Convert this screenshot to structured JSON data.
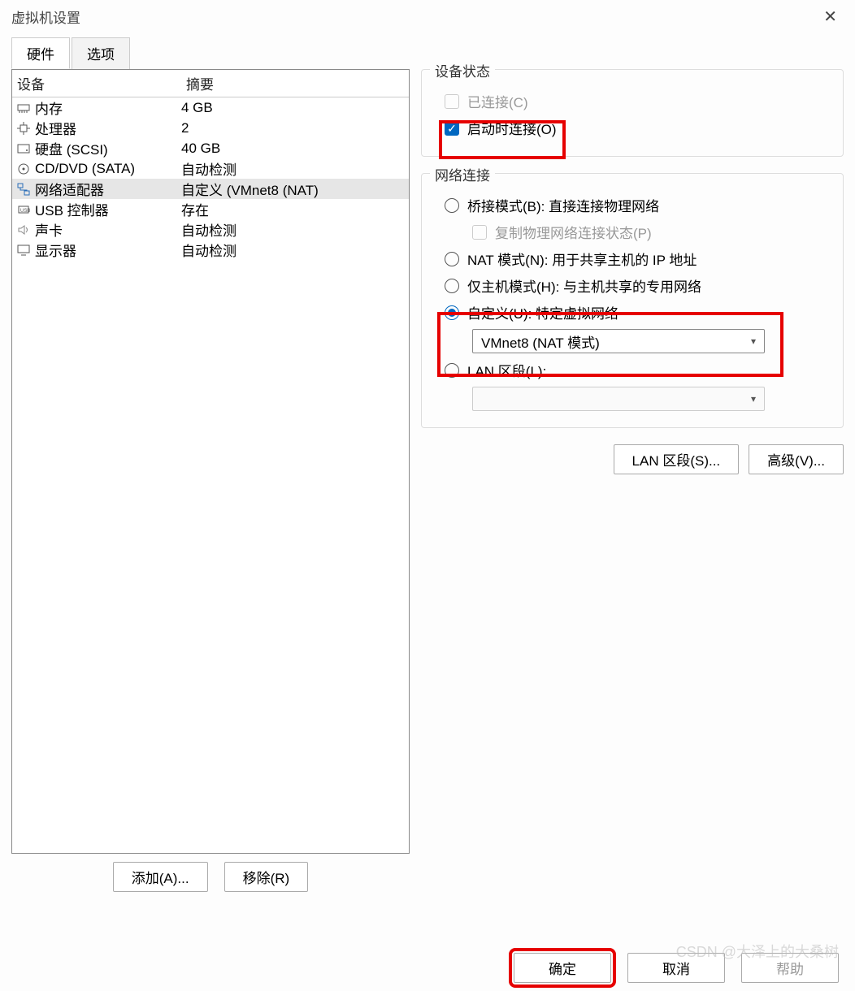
{
  "window": {
    "title": "虚拟机设置"
  },
  "tabs": {
    "hardware": "硬件",
    "options": "选项"
  },
  "table": {
    "col_device": "设备",
    "col_summary": "摘要",
    "rows": [
      {
        "icon": "memory-icon",
        "label": "内存",
        "summary": "4 GB"
      },
      {
        "icon": "cpu-icon",
        "label": "处理器",
        "summary": "2"
      },
      {
        "icon": "hdd-icon",
        "label": "硬盘 (SCSI)",
        "summary": "40 GB"
      },
      {
        "icon": "disc-icon",
        "label": "CD/DVD (SATA)",
        "summary": "自动检测"
      },
      {
        "icon": "network-icon",
        "label": "网络适配器",
        "summary": "自定义 (VMnet8 (NAT)"
      },
      {
        "icon": "usb-icon",
        "label": "USB 控制器",
        "summary": "存在"
      },
      {
        "icon": "sound-icon",
        "label": "声卡",
        "summary": "自动检测"
      },
      {
        "icon": "display-icon",
        "label": "显示器",
        "summary": "自动检测"
      }
    ]
  },
  "actions": {
    "add": "添加(A)...",
    "remove": "移除(R)"
  },
  "status": {
    "title": "设备状态",
    "connected": "已连接(C)",
    "connect_on_start": "启动时连接(O)"
  },
  "network": {
    "title": "网络连接",
    "bridged": "桥接模式(B): 直接连接物理网络",
    "replicate": "复制物理网络连接状态(P)",
    "nat": "NAT 模式(N): 用于共享主机的 IP 地址",
    "hostonly": "仅主机模式(H): 与主机共享的专用网络",
    "custom": "自定义(U): 特定虚拟网络",
    "custom_value": "VMnet8 (NAT 模式)",
    "lan": "LAN 区段(L):",
    "lan_value": "",
    "btn_lan": "LAN 区段(S)...",
    "btn_adv": "高级(V)..."
  },
  "footer": {
    "ok": "确定",
    "cancel": "取消",
    "help": "帮助"
  },
  "watermark": "CSDN @大泽上的大桑树"
}
